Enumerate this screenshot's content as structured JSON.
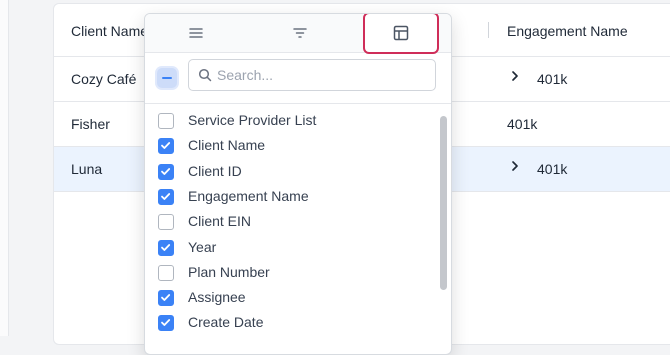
{
  "grid": {
    "headers": {
      "client": "Client Name",
      "engagement": "Engagement Name"
    },
    "rows": [
      {
        "client": "Cozy Café",
        "engagement": "401k",
        "expandable": true,
        "selected": false
      },
      {
        "client": "Fisher",
        "engagement": "401k",
        "expandable": false,
        "selected": false
      },
      {
        "client": "Luna",
        "engagement": "401k",
        "expandable": true,
        "selected": true
      }
    ]
  },
  "column_menu": {
    "tabs": [
      {
        "icon": "menu-lines-icon",
        "active": false
      },
      {
        "icon": "filter-icon",
        "active": false
      },
      {
        "icon": "columns-icon",
        "active": true
      }
    ],
    "search": {
      "placeholder": "Search...",
      "value": ""
    },
    "columns": [
      {
        "label": "Service Provider List",
        "checked": false
      },
      {
        "label": "Client Name",
        "checked": true
      },
      {
        "label": "Client ID",
        "checked": true
      },
      {
        "label": "Engagement Name",
        "checked": true
      },
      {
        "label": "Client EIN",
        "checked": false
      },
      {
        "label": "Year",
        "checked": true
      },
      {
        "label": "Plan Number",
        "checked": false
      },
      {
        "label": "Assignee",
        "checked": true
      },
      {
        "label": "Create Date",
        "checked": true
      }
    ]
  },
  "colors": {
    "accent": "#3b82f6",
    "highlight_border": "#cf2d59",
    "selected_row": "#ebf3fe"
  }
}
